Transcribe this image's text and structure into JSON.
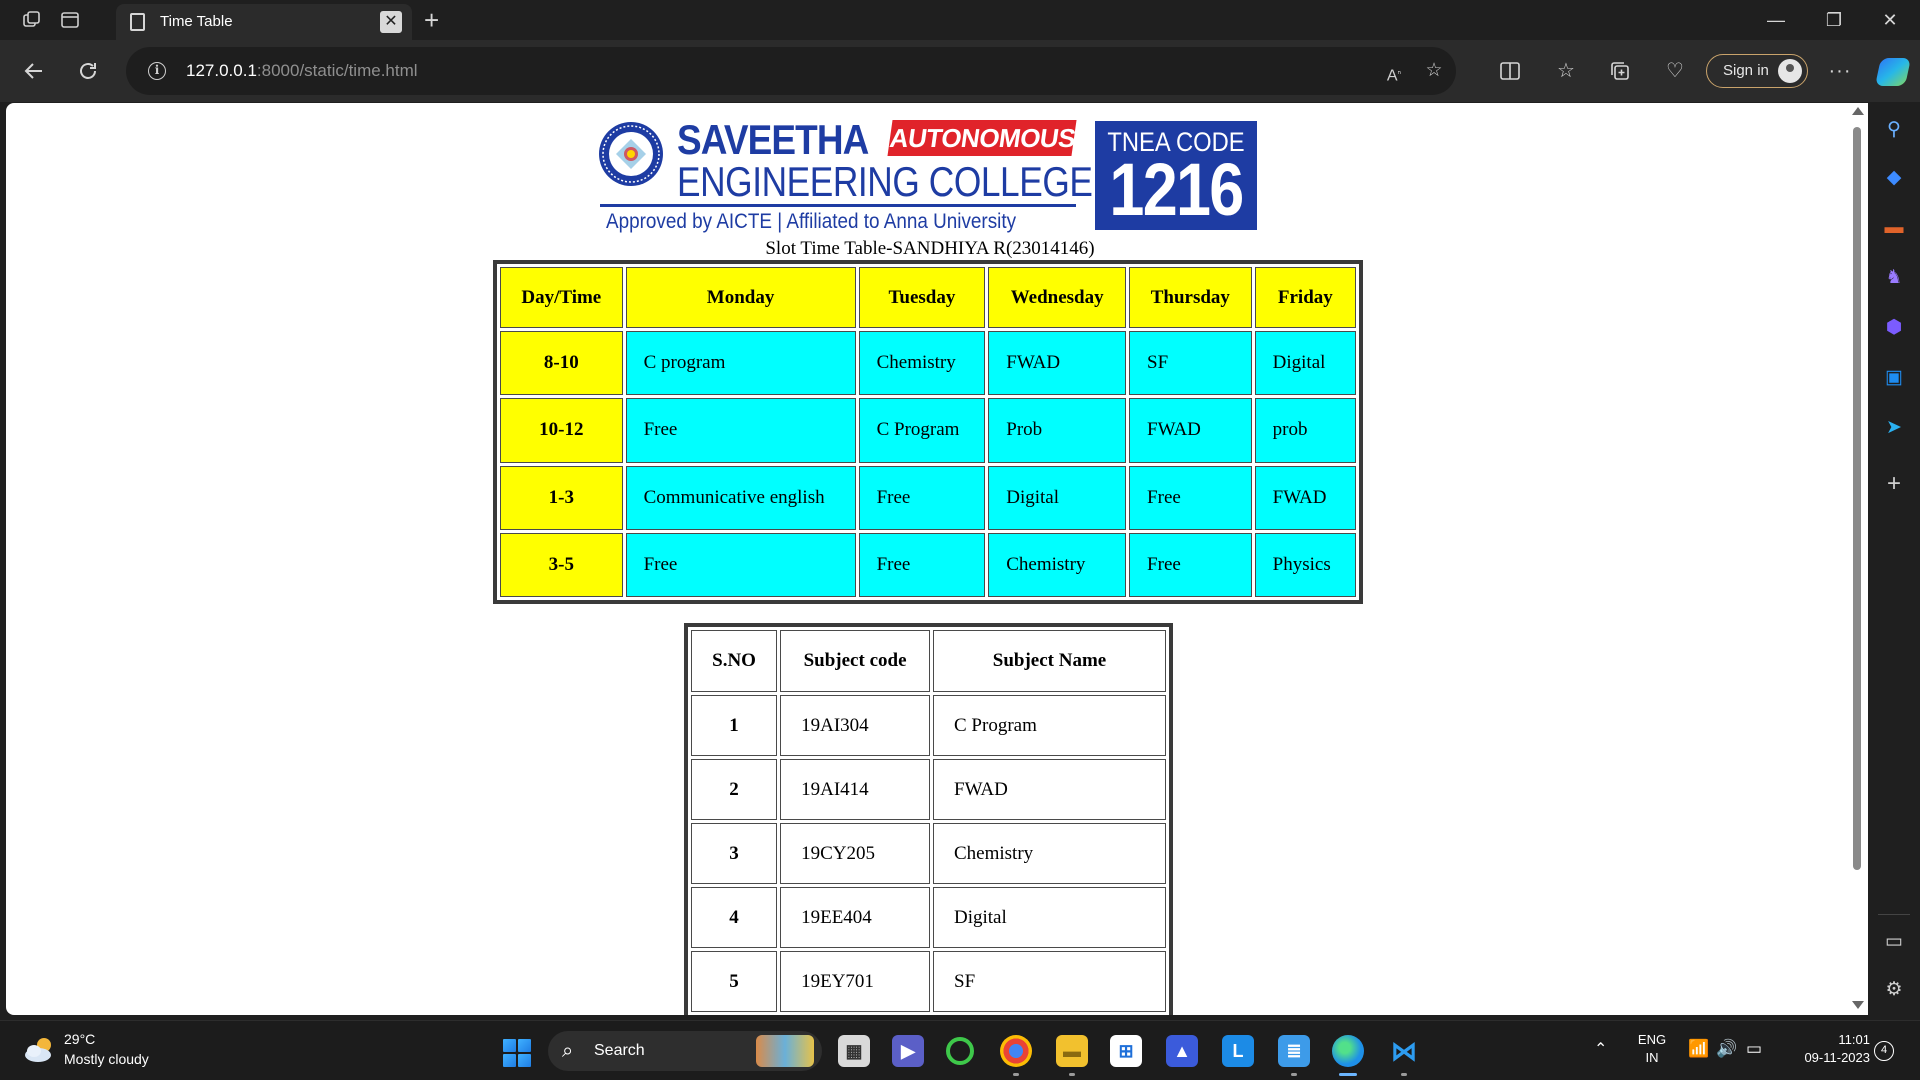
{
  "browser": {
    "tab_title": "Time Table",
    "url_host": "127.0.0.1",
    "url_rest": ":8000/static/time.html",
    "signin_label": "Sign in"
  },
  "logo": {
    "name": "SAVEETHA",
    "badge": "AUTONOMOUS",
    "college": "ENGINEERING COLLEGE",
    "approved": "Approved by AICTE  |  Affiliated to Anna University",
    "code_label": "TNEA CODE",
    "code_value": "1216"
  },
  "caption": "Slot Time Table-SANDHIYA R(23014146)",
  "timetable": {
    "headers": [
      "Day/Time",
      "Monday",
      "Tuesday",
      "Wednesday",
      "Thursday",
      "Friday"
    ],
    "rows": [
      {
        "slot": "8-10",
        "cells": [
          "C program",
          "Chemistry",
          "FWAD",
          "SF",
          "Digital"
        ]
      },
      {
        "slot": "10-12",
        "cells": [
          "Free",
          "C Program",
          "Prob",
          "FWAD",
          "prob"
        ]
      },
      {
        "slot": "1-3",
        "cells": [
          "Communicative english",
          "Free",
          "Digital",
          "Free",
          "FWAD"
        ]
      },
      {
        "slot": "3-5",
        "cells": [
          "Free",
          "Free",
          "Chemistry",
          "Free",
          "Physics"
        ]
      }
    ]
  },
  "subjects": {
    "headers": [
      "S.NO",
      "Subject code",
      "Subject Name"
    ],
    "rows": [
      {
        "sno": "1",
        "code": "19AI304",
        "name": "C Program"
      },
      {
        "sno": "2",
        "code": "19AI414",
        "name": "FWAD"
      },
      {
        "sno": "3",
        "code": "19CY205",
        "name": "Chemistry"
      },
      {
        "sno": "4",
        "code": "19EE404",
        "name": "Digital"
      },
      {
        "sno": "5",
        "code": "19EY701",
        "name": "SF"
      }
    ]
  },
  "taskbar": {
    "temperature": "29°C",
    "weather": "Mostly cloudy",
    "search_label": "Search",
    "lang_line1": "ENG",
    "lang_line2": "IN",
    "time": "11:01",
    "date": "09-11-2023",
    "notification_count": "4"
  },
  "colors": {
    "header_cell": "#ffff00",
    "body_cell": "#00ffff",
    "logo_blue": "#1e3ca3",
    "logo_red": "#e0232a"
  }
}
